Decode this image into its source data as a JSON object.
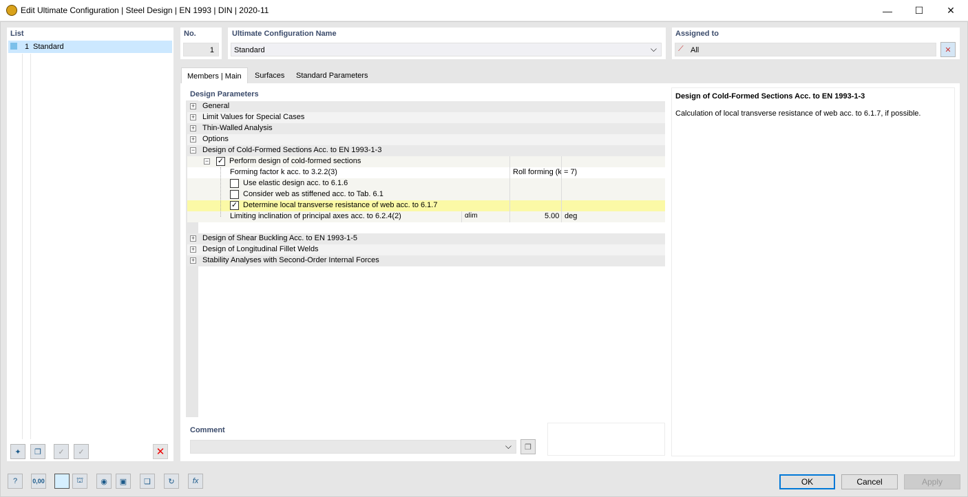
{
  "window": {
    "title": "Edit Ultimate Configuration | Steel Design | EN 1993 | DIN | 2020-11",
    "minimize": "—",
    "maximize": "☐",
    "close": "✕"
  },
  "list": {
    "header": "List",
    "items": [
      {
        "number": "1",
        "label": "Standard"
      }
    ]
  },
  "config": {
    "no_label": "No.",
    "no_value": "1",
    "name_label": "Ultimate Configuration Name",
    "name_value": "Standard",
    "assigned_label": "Assigned to",
    "assigned_value": "All"
  },
  "tabs": [
    "Members | Main",
    "Surfaces",
    "Standard Parameters"
  ],
  "design_params": {
    "header": "Design Parameters",
    "groups_top": [
      "General",
      "Limit Values for Special Cases",
      "Thin-Walled Analysis",
      "Options"
    ],
    "cold_formed": {
      "label": "Design of Cold-Formed Sections Acc. to EN 1993-1-3",
      "perform": "Perform design of cold-formed sections",
      "forming_label": "Forming factor k acc. to 3.2.2(3)",
      "forming_value": "Roll forming (k = 7)",
      "elastic": "Use elastic design acc. to 6.1.6",
      "stiffened": "Consider web as stiffened acc. to Tab. 6.1",
      "transverse": "Determine local transverse resistance of web acc. to 6.1.7",
      "inclination_label": "Limiting inclination of principal axes acc. to 6.2.4(2)",
      "inclination_symbol": "αlim",
      "inclination_value": "5.00",
      "inclination_unit": "deg"
    },
    "groups_bottom": [
      "Design of Shear Buckling Acc. to EN 1993-1-5",
      "Design of Longitudinal Fillet Welds",
      "Stability Analyses with Second-Order Internal Forces"
    ]
  },
  "info": {
    "title": "Design of Cold-Formed Sections Acc. to EN 1993-1-3",
    "text": "Calculation of local transverse resistance of web acc. to 6.1.7, if possible."
  },
  "comment": {
    "label": "Comment",
    "value": ""
  },
  "buttons": {
    "ok": "OK",
    "cancel": "Cancel",
    "apply": "Apply"
  },
  "bottom_icons": [
    "help-icon",
    "units-icon",
    "color-icon",
    "model-icon",
    "view-icon",
    "save-icon",
    "copy-icon",
    "reset-icon",
    "formula-icon"
  ],
  "units_icon_text": "0,00",
  "colors": {
    "highlight": "#fbf9a6",
    "accent": "#0078d7",
    "header": "#3b4b6b"
  }
}
